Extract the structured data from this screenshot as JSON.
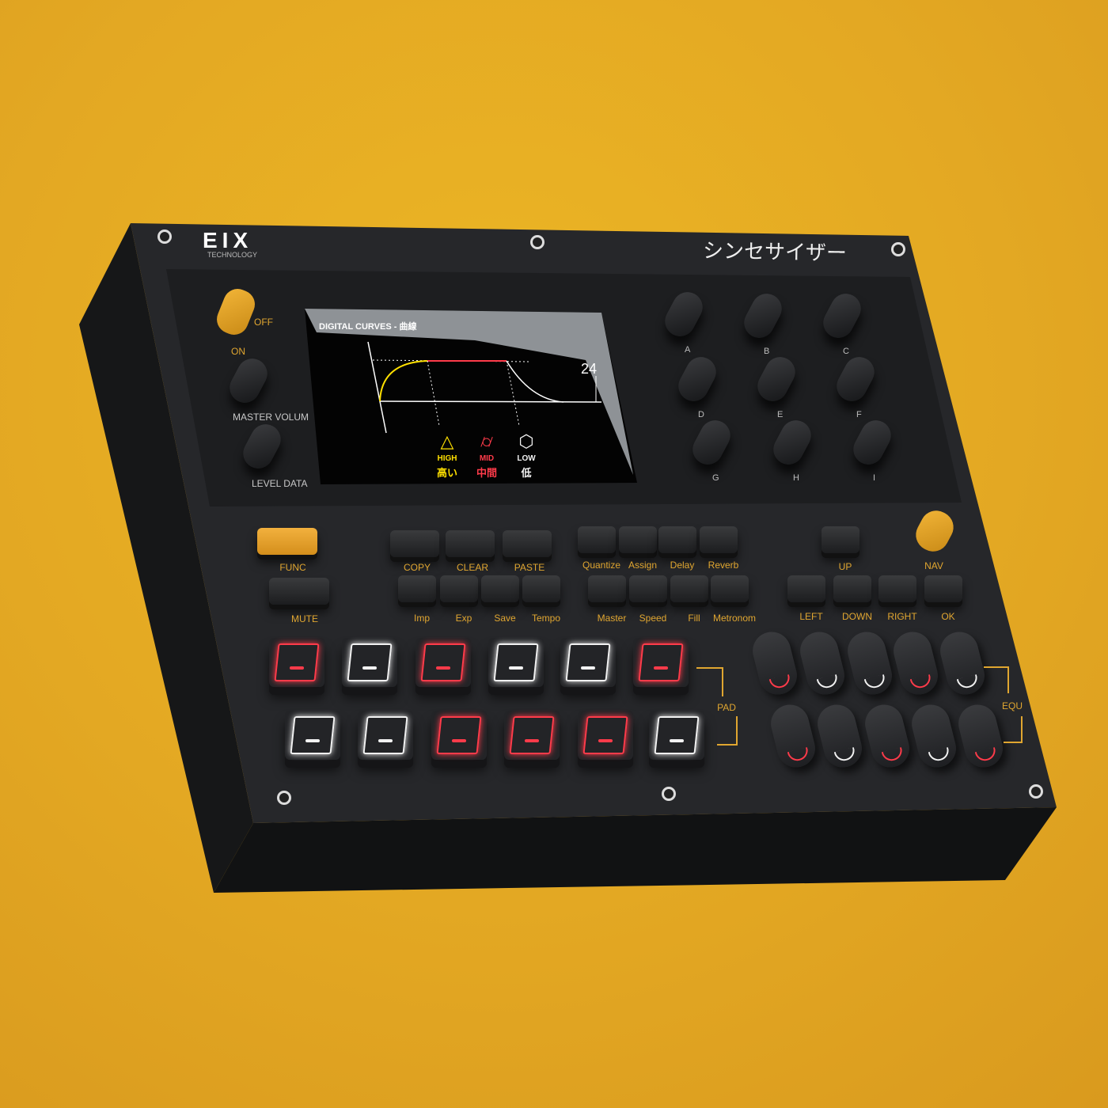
{
  "device": {
    "brand": "EIX",
    "brand_sub": "TECHNOLOGY",
    "title_jp": "シンセサイザー",
    "colors": {
      "background": "#e6ad23",
      "body": "#232427",
      "accent": "#e0a630",
      "red": "#ff3b4a",
      "white": "#f2f2f2",
      "yellow": "#ffe000"
    }
  },
  "left_controls": {
    "off": "OFF",
    "on": "ON",
    "master_volume": "MASTER VOLUM",
    "level_data": "LEVEL DATA"
  },
  "screen": {
    "title": "DIGITAL CURVES  -  曲線",
    "value": "24",
    "bands": [
      {
        "label": "HIGH",
        "jp": "高い",
        "color": "#ffe000",
        "icon": "pyramid-icon"
      },
      {
        "label": "MID",
        "jp": "中間",
        "color": "#ff3b4a",
        "icon": "cylinder-icon"
      },
      {
        "label": "LOW",
        "jp": "低",
        "color": "#f2f2f2",
        "icon": "cube-icon"
      }
    ]
  },
  "knobs": [
    "A",
    "B",
    "C",
    "D",
    "E",
    "F",
    "G",
    "H",
    "I"
  ],
  "buttons": {
    "func": "FUNC",
    "mute": "MUTE",
    "edit": [
      "COPY",
      "CLEAR",
      "PASTE"
    ],
    "file": [
      "Imp",
      "Exp",
      "Save",
      "Tempo"
    ],
    "fx": [
      "Quantize",
      "Assign",
      "Delay",
      "Reverb"
    ],
    "mix": [
      "Master",
      "Speed",
      "Fill",
      "Metronom"
    ],
    "nav_up": "UP",
    "nav": "NAV",
    "nav_row": [
      "LEFT",
      "DOWN",
      "RIGHT",
      "OK"
    ]
  },
  "pads": {
    "label": "PAD",
    "top": [
      "red",
      "white",
      "red",
      "white",
      "white",
      "red"
    ],
    "bottom": [
      "white",
      "white",
      "red",
      "red",
      "red",
      "white"
    ]
  },
  "equ": {
    "label": "EQU",
    "top": [
      "red",
      "white",
      "white",
      "red",
      "white"
    ],
    "bottom": [
      "red",
      "white",
      "red",
      "white",
      "red"
    ]
  }
}
